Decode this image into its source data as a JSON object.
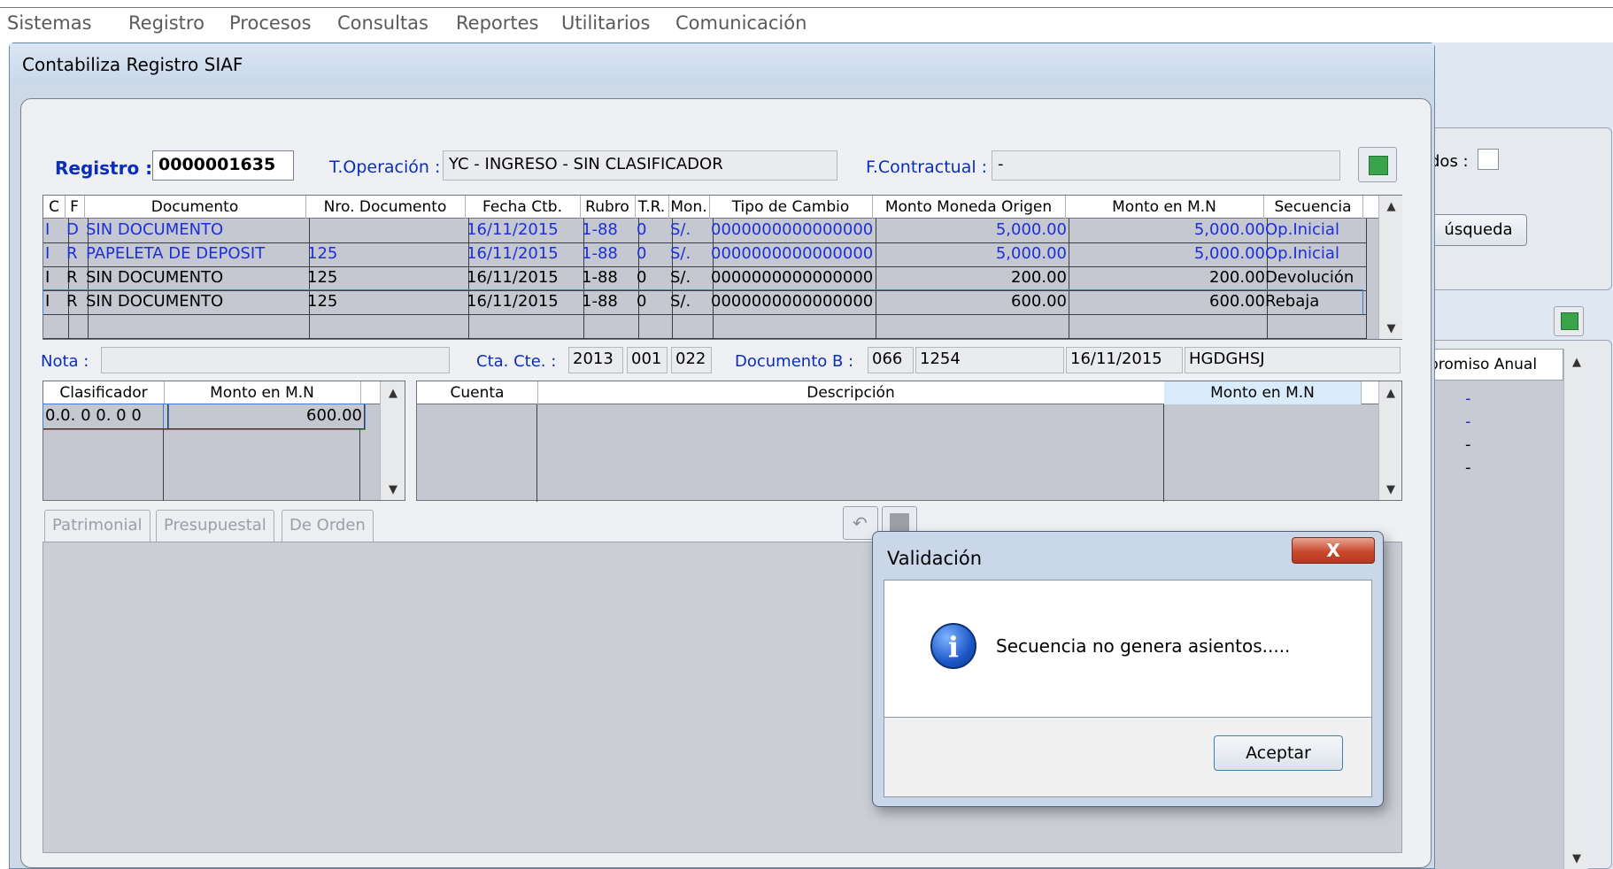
{
  "menu": [
    "Sistemas",
    "Registro",
    "Procesos",
    "Consultas",
    "Reportes",
    "Utilitarios",
    "Comunicación"
  ],
  "window": {
    "title": "Contabiliza Registro SIAF"
  },
  "header": {
    "registro_label": "Registro :",
    "registro_value": "0000001635",
    "toperacion_label": "T.Operación :",
    "toperacion_value": "YC - INGRESO - SIN CLASIFICADOR",
    "fcontractual_label": "F.Contractual :",
    "fcontractual_value": "-"
  },
  "main_grid": {
    "columns": [
      "C",
      "F",
      "Documento",
      "Nro. Documento",
      "Fecha Ctb.",
      "Rubro",
      "T.R.",
      "Mon.",
      "Tipo de Cambio",
      "Monto Moneda Origen",
      "Monto en M.N",
      "Secuencia"
    ],
    "rows": [
      {
        "c": "I",
        "f": "D",
        "documento": "SIN DOCUMENTO",
        "nro": "",
        "fecha": "16/11/2015",
        "rubro": "1-88",
        "tr": "0",
        "mon": "S/.",
        "tipo": "0000000000000000",
        "origen": "5,000.00",
        "mn": "5,000.00",
        "secuencia": "Op.Inicial"
      },
      {
        "c": "I",
        "f": "R",
        "documento": "PAPELETA DE DEPOSIT",
        "nro": "125",
        "fecha": "16/11/2015",
        "rubro": "1-88",
        "tr": "0",
        "mon": "S/.",
        "tipo": "0000000000000000",
        "origen": "5,000.00",
        "mn": "5,000.00",
        "secuencia": "Op.Inicial"
      },
      {
        "c": "I",
        "f": "R",
        "documento": "SIN DOCUMENTO",
        "nro": "125",
        "fecha": "16/11/2015",
        "rubro": "1-88",
        "tr": "0",
        "mon": "S/.",
        "tipo": "0000000000000000",
        "origen": "200.00",
        "mn": "200.00",
        "secuencia": "Devolución"
      },
      {
        "c": "I",
        "f": "R",
        "documento": "SIN DOCUMENTO",
        "nro": "125",
        "fecha": "16/11/2015",
        "rubro": "1-88",
        "tr": "0",
        "mon": "S/.",
        "tipo": "0000000000000000",
        "origen": "600.00",
        "mn": "600.00",
        "secuencia": "Rebaja"
      }
    ]
  },
  "info_row": {
    "nota_label": "Nota :",
    "nota_value": "",
    "ctacte_label": "Cta. Cte. :",
    "ctacte_values": [
      "2013",
      "001",
      "022"
    ],
    "documentob_label": "Documento B :",
    "documentob_values": [
      "066",
      "1254"
    ],
    "fecha": "16/11/2015",
    "codigo": "HGDGHSJ"
  },
  "clasificador_grid": {
    "columns": [
      "Clasificador",
      "Monto en M.N"
    ],
    "rows": [
      {
        "clasificador": "0.0. 0 0. 0 0",
        "monto": "600.00"
      }
    ]
  },
  "cuenta_grid": {
    "columns": [
      "Cuenta",
      "Descripción",
      "Monto en M.N"
    ]
  },
  "tabs": [
    "Patrimonial",
    "Presupuestal",
    "De Orden"
  ],
  "background_window": {
    "label": "dos :",
    "button": "úsqueda",
    "column": "promiso Anual",
    "dashes": [
      "-",
      "-",
      "-",
      "-"
    ]
  },
  "dialog": {
    "title": "Validación",
    "close": "X",
    "message": "Secuencia no genera asientos.....",
    "button": "Aceptar",
    "icon": "info-icon"
  },
  "colors": {
    "accent_blue": "#1c2fd8",
    "window_bg": "#cdd9e7",
    "grid_gray": "#c5c8d0"
  }
}
